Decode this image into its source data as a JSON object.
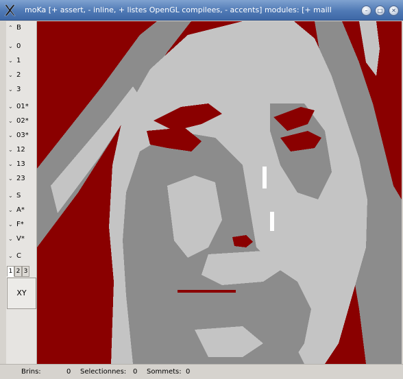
{
  "window": {
    "title": "moKa [+ assert, - inline, + listes OpenGL compilees, - accents] modules: [+ maill",
    "buttons": {
      "minimize": "–",
      "maximize": "□",
      "close": "✕"
    }
  },
  "toolbar": {
    "items": [
      {
        "label": "B",
        "icon": "chevron-up"
      },
      {
        "label": "0",
        "icon": "chevron-down"
      },
      {
        "label": "1",
        "icon": "chevron-down"
      },
      {
        "label": "2",
        "icon": "chevron-down"
      },
      {
        "label": "3",
        "icon": "chevron-down"
      },
      {
        "label": "01*",
        "icon": "chevron-down"
      },
      {
        "label": "02*",
        "icon": "chevron-down"
      },
      {
        "label": "03*",
        "icon": "chevron-down"
      },
      {
        "label": "12",
        "icon": "chevron-down"
      },
      {
        "label": "13",
        "icon": "chevron-down"
      },
      {
        "label": "23",
        "icon": "chevron-down"
      },
      {
        "label": "S",
        "icon": "chevron-down"
      },
      {
        "label": "A*",
        "icon": "chevron-down"
      },
      {
        "label": "F*",
        "icon": "chevron-down"
      },
      {
        "label": "V*",
        "icon": "chevron-down"
      },
      {
        "label": "C",
        "icon": "chevron-down"
      }
    ],
    "tabs": [
      "1",
      "2",
      "3"
    ],
    "active_tab": "1",
    "xy_label": "XY"
  },
  "status": {
    "brins_label": "Brins:",
    "brins_value": "0",
    "selectionnes_label": "Selectionnes:",
    "selectionnes_value": "0",
    "sommets_label": "Sommets:",
    "sommets_value": "0"
  },
  "colors": {
    "background_region": "#8a0000",
    "mid_gray": "#8c8c8c",
    "light_gray": "#c4c4c4",
    "highlight": "#ffffff",
    "titlebar": "#4f79b5"
  }
}
